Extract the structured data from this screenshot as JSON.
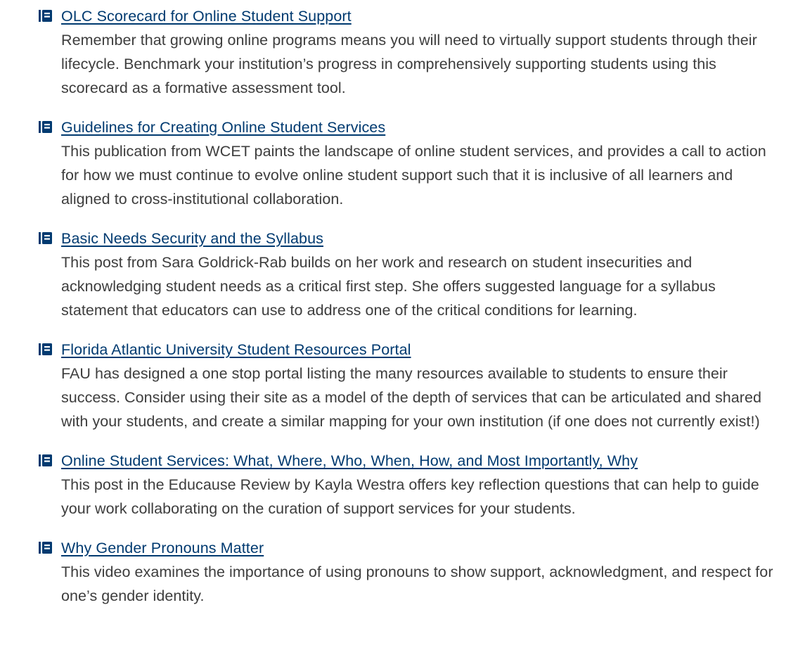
{
  "resources": [
    {
      "icon": "book-icon",
      "title": "OLC Scorecard for Online Student Support",
      "description": "Remember that growing online programs means you will need to virtually support students through their lifecycle. Benchmark your institution’s progress in comprehensively supporting students using this scorecard as a formative assessment tool."
    },
    {
      "icon": "book-icon",
      "title": "Guidelines for Creating Online Student Services",
      "description": "This publication from WCET paints the landscape of online student services, and provides a call to action for how we must continue to evolve online student support such that it is inclusive of all learners and aligned to cross-institutional collaboration."
    },
    {
      "icon": "book-icon",
      "title": "Basic Needs Security and the Syllabus",
      "description": "This post from Sara Goldrick-Rab builds on her work and research on student insecurities and acknowledging student needs as a critical first step. She offers suggested language for a syllabus statement that educators can use to address one of the critical conditions for learning."
    },
    {
      "icon": "book-icon",
      "title": "Florida Atlantic University Student Resources Portal",
      "description": "FAU has designed a one stop portal listing the many resources available to students to ensure their success. Consider using their site as a model of the depth of services that can be articulated and shared with your students, and create a similar mapping for your own institution (if one does not currently exist!)"
    },
    {
      "icon": "book-icon",
      "title": "Online Student Services: What, Where, Who, When, How, and Most Importantly, Why",
      "description": "This post in the Educause Review by Kayla Westra offers key reflection questions that can help to guide your work collaborating on the curation of support services for your students."
    },
    {
      "icon": "book-icon",
      "title": "Why Gender Pronouns Matter",
      "description": "This video examines the importance of using pronouns to show support, acknowledgment, and respect for one’s gender identity."
    }
  ],
  "colors": {
    "link": "#003a70",
    "icon": "#003a70",
    "text": "#3d3d3d"
  }
}
